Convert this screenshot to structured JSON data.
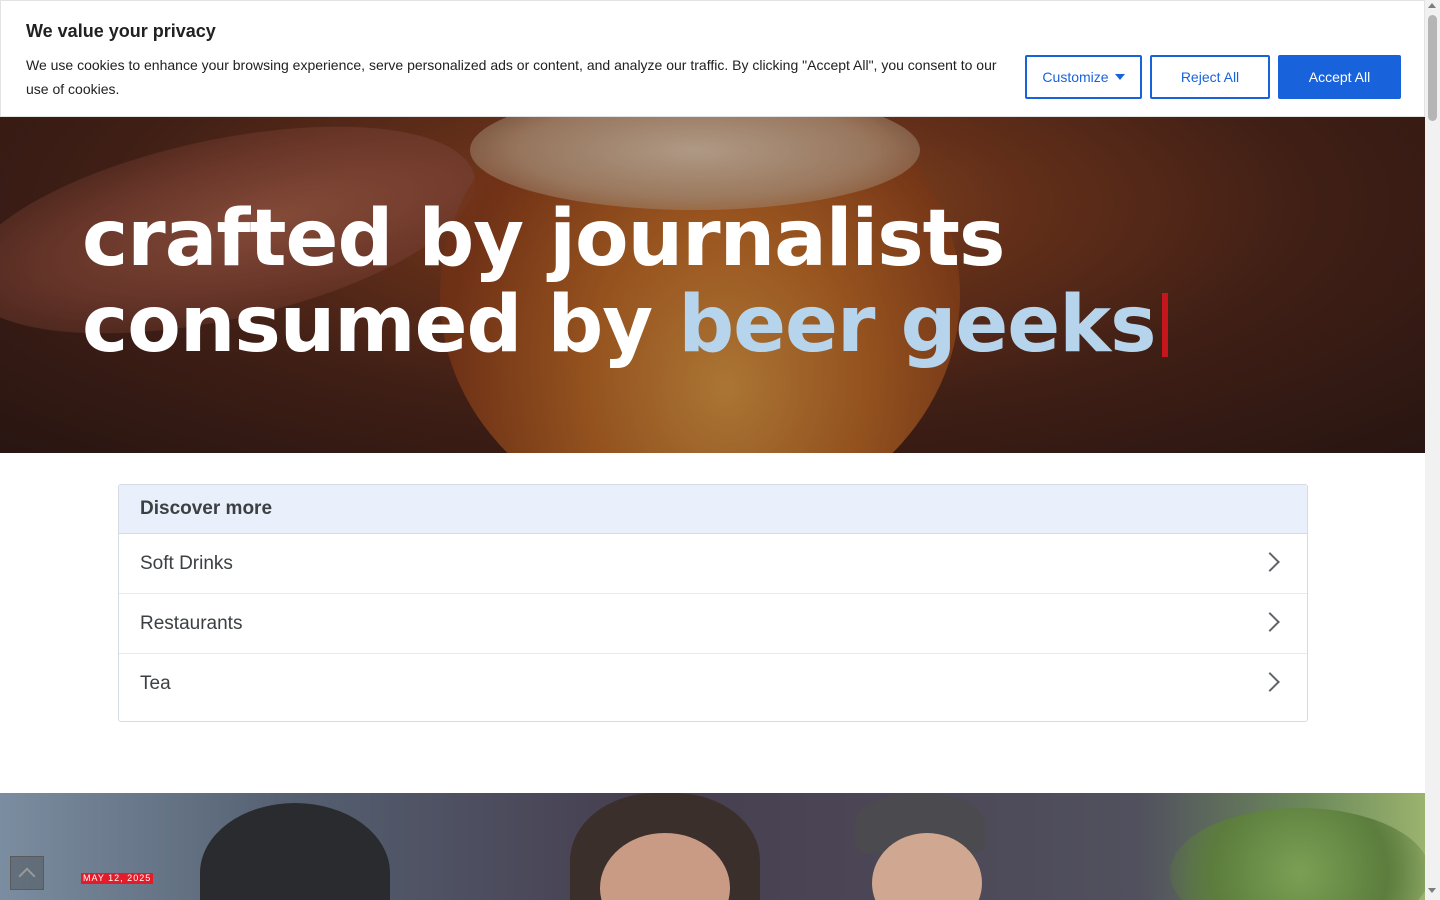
{
  "cookie_banner": {
    "title": "We value your privacy",
    "text": "We use cookies to enhance your browsing experience, serve personalized ads or content, and analyze our traffic. By clicking \"Accept All\", you consent to our use of cookies.",
    "customize_label": "Customize",
    "reject_label": "Reject All",
    "accept_label": "Accept All",
    "accent_color": "#1863dc"
  },
  "hero": {
    "line_start": "crafted by journalists consumed by ",
    "accent_text": "beer geeks",
    "accent_color": "#b6d5ec",
    "cursor_color": "#c4161c"
  },
  "discover": {
    "title": "Discover more",
    "items": [
      {
        "label": "Soft Drinks"
      },
      {
        "label": "Restaurants"
      },
      {
        "label": "Tea"
      }
    ]
  },
  "article": {
    "date": "MAY 12, 2025",
    "badge_color": "#e11d2b"
  }
}
